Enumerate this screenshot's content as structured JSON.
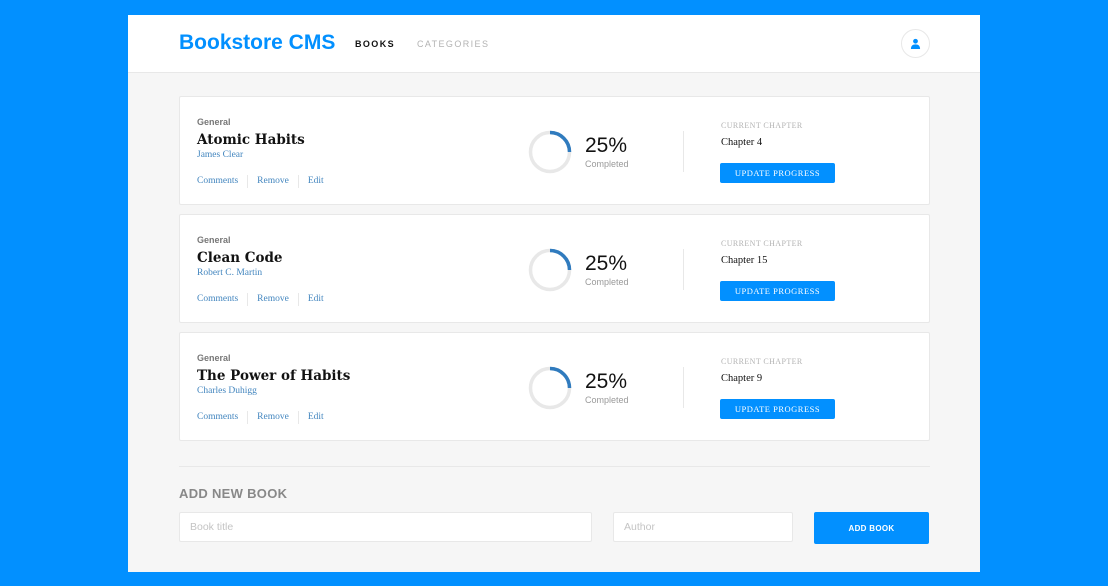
{
  "header": {
    "logo": "Bookstore CMS",
    "nav": [
      {
        "label": "BOOKS",
        "active": true
      },
      {
        "label": "CATEGORIES",
        "active": false
      }
    ],
    "user_icon": "user-icon"
  },
  "books": [
    {
      "genre": "General",
      "title": "Atomic Habits",
      "author": "James Clear",
      "actions": [
        "Comments",
        "Remove",
        "Edit"
      ],
      "progress_percent": 25,
      "percent_label": "25%",
      "completed_label": "Completed",
      "chapter_label": "CURRENT CHAPTER",
      "chapter": "Chapter 4",
      "update_label": "UPDATE PROGRESS"
    },
    {
      "genre": "General",
      "title": "Clean Code",
      "author": "Robert C. Martin",
      "actions": [
        "Comments",
        "Remove",
        "Edit"
      ],
      "progress_percent": 25,
      "percent_label": "25%",
      "completed_label": "Completed",
      "chapter_label": "CURRENT CHAPTER",
      "chapter": "Chapter 15",
      "update_label": "UPDATE PROGRESS"
    },
    {
      "genre": "General",
      "title": "The Power of Habits",
      "author": "Charles Duhigg",
      "actions": [
        "Comments",
        "Remove",
        "Edit"
      ],
      "progress_percent": 25,
      "percent_label": "25%",
      "completed_label": "Completed",
      "chapter_label": "CURRENT CHAPTER",
      "chapter": "Chapter 9",
      "update_label": "UPDATE PROGRESS"
    }
  ],
  "add_form": {
    "title": "ADD NEW BOOK",
    "title_placeholder": "Book title",
    "author_placeholder": "Author",
    "button_label": "ADD BOOK"
  },
  "colors": {
    "primary": "#0290ff",
    "progress_arc": "#307bbe",
    "progress_track": "#e8e8e8"
  }
}
